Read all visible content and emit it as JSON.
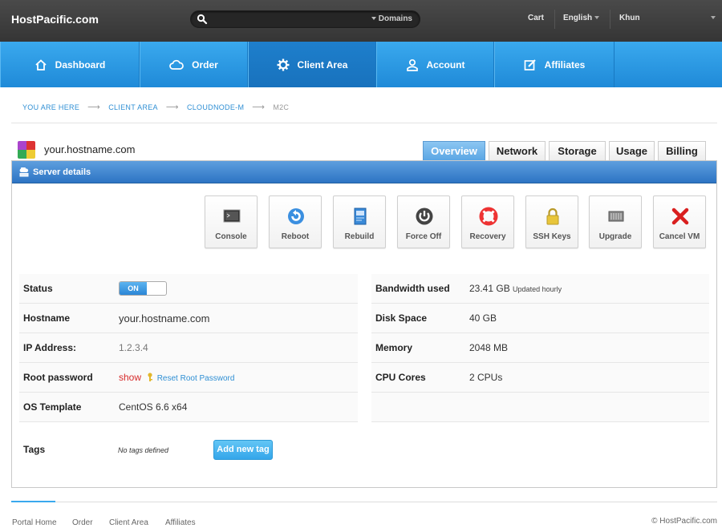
{
  "brand": "HostPacific.com",
  "search": {
    "placeholder": "",
    "domains_label": "Domains"
  },
  "topbar": {
    "cart": "Cart",
    "language": "English",
    "user": "Khun"
  },
  "nav": [
    {
      "label": "Dashboard",
      "icon": "home-icon"
    },
    {
      "label": "Order",
      "icon": "cloud-icon"
    },
    {
      "label": "Client Area",
      "icon": "gear-icon"
    },
    {
      "label": "Account",
      "icon": "user-icon"
    },
    {
      "label": "Affiliates",
      "icon": "edit-icon"
    }
  ],
  "breadcrumb": [
    "YOU ARE HERE",
    "CLIENT AREA",
    "CLOUDNODE-M",
    "M2C"
  ],
  "breadcrumb_sep": "⟶",
  "server": {
    "hostname": "your.hostname.com"
  },
  "tabs": [
    "Overview",
    "Network",
    "Storage",
    "Usage",
    "Billing"
  ],
  "panel_title": "Server details",
  "actions": [
    {
      "label": "Console",
      "icon": "console-icon"
    },
    {
      "label": "Reboot",
      "icon": "reboot-icon"
    },
    {
      "label": "Rebuild",
      "icon": "rebuild-icon"
    },
    {
      "label": "Force Off",
      "icon": "power-icon"
    },
    {
      "label": "Recovery",
      "icon": "lifebuoy-icon"
    },
    {
      "label": "SSH Keys",
      "icon": "lock-icon"
    },
    {
      "label": "Upgrade",
      "icon": "chip-icon"
    },
    {
      "label": "Cancel VM",
      "icon": "cancel-icon"
    }
  ],
  "details_left": {
    "status_label": "Status",
    "status_value": "ON",
    "hostname_label": "Hostname",
    "hostname_value": "your.hostname.com",
    "ip_label": "IP Address:",
    "ip_value": "1.2.3.4",
    "root_label": "Root password",
    "root_show": "show",
    "root_reset": "Reset Root Password",
    "os_label": "OS Template",
    "os_value": "CentOS 6.6 x64"
  },
  "details_right": {
    "bw_label": "Bandwidth used",
    "bw_value": "23.41 GB",
    "bw_note": "Updated hourly",
    "disk_label": "Disk Space",
    "disk_value": "40 GB",
    "mem_label": "Memory",
    "mem_value": "2048 MB",
    "cpu_label": "CPU Cores",
    "cpu_value": "2 CPUs"
  },
  "tags": {
    "label": "Tags",
    "empty": "No tags defined",
    "add_button": "Add new tag"
  },
  "footer": {
    "links": [
      "Portal Home",
      "Order",
      "Client Area",
      "Affiliates"
    ],
    "copyright": "© HostPacific.com"
  },
  "colors": {
    "nav_blue": "#2a9be6",
    "active_tab": "#5aa6e4",
    "header_blue": "#3b82cf",
    "danger": "#d62b2b"
  }
}
